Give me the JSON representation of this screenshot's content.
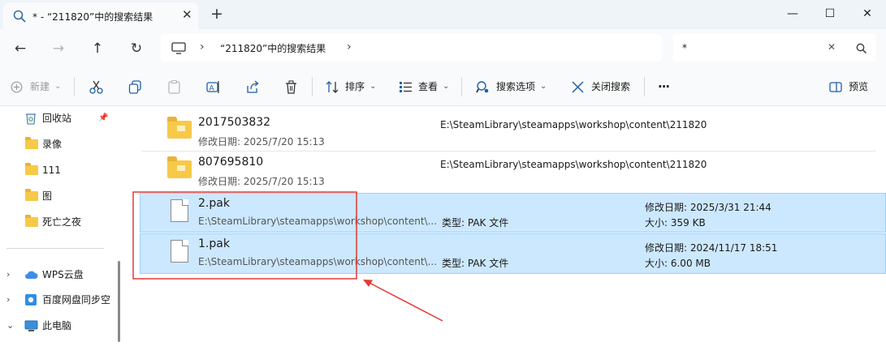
{
  "window": {
    "tab_title": "* - “211820”中的搜索结果",
    "tab_close": "✕",
    "new_tab": "+",
    "minimize": "—",
    "maximize": "☐",
    "close": "✕"
  },
  "nav": {
    "back": "←",
    "forward": "→",
    "up": "↑",
    "refresh": "↻"
  },
  "address": {
    "breadcrumb_sep": "›",
    "crumb": "“211820”中的搜索结果",
    "expand": "›"
  },
  "search": {
    "value": "*",
    "clear": "✕",
    "icon": "⌕"
  },
  "toolbar": {
    "new_label": "新建",
    "sort_label": "排序",
    "view_label": "查看",
    "search_options_label": "搜索选项",
    "close_search_label": "关闭搜索",
    "more_label": "···",
    "preview_label": "预览",
    "dropdown_caret": "⌄"
  },
  "sidebar": {
    "pin": "📌",
    "items": [
      {
        "label": "回收站",
        "icon": "recycle-bin-icon"
      },
      {
        "label": "录像",
        "icon": "folder-icon"
      },
      {
        "label": "111",
        "icon": "folder-icon"
      },
      {
        "label": "图",
        "icon": "folder-icon"
      },
      {
        "label": "死亡之夜",
        "icon": "folder-icon"
      }
    ],
    "tree": [
      {
        "label": "WPS云盘",
        "chevron": "›",
        "icon": "cloud-icon"
      },
      {
        "label": "百度网盘同步空",
        "chevron": "›",
        "icon": "baidu-sync-icon"
      },
      {
        "label": "此电脑",
        "chevron": "⌄",
        "icon": "computer-icon"
      }
    ]
  },
  "files": [
    {
      "name": "2017503832",
      "sub": "修改日期: 2025/7/20 15:13",
      "path": "E:\\SteamLibrary\\steamapps\\workshop\\content\\211820",
      "type": "",
      "modified": "",
      "size": "",
      "kind": "folder"
    },
    {
      "name": "807695810",
      "sub": "修改日期: 2025/7/20 15:13",
      "path": "E:\\SteamLibrary\\steamapps\\workshop\\content\\211820",
      "type": "",
      "modified": "",
      "size": "",
      "kind": "folder"
    },
    {
      "name": "2.pak",
      "sub": "E:\\SteamLibrary\\steamapps\\workshop\\content\\...",
      "path": "",
      "type": "类型: PAK 文件",
      "modified": "修改日期: 2025/3/31 21:44",
      "size": "大小: 359 KB",
      "kind": "file"
    },
    {
      "name": "1.pak",
      "sub": "E:\\SteamLibrary\\steamapps\\workshop\\content\\...",
      "path": "",
      "type": "类型: PAK 文件",
      "modified": "修改日期: 2024/11/17 18:51",
      "size": "大小: 6.00 MB",
      "kind": "file"
    }
  ],
  "colors": {
    "selection_bg": "#cce8ff",
    "selection_border": "#99d1ff",
    "annotation_red": "#e53935",
    "folder_yellow": "#f7c948"
  }
}
